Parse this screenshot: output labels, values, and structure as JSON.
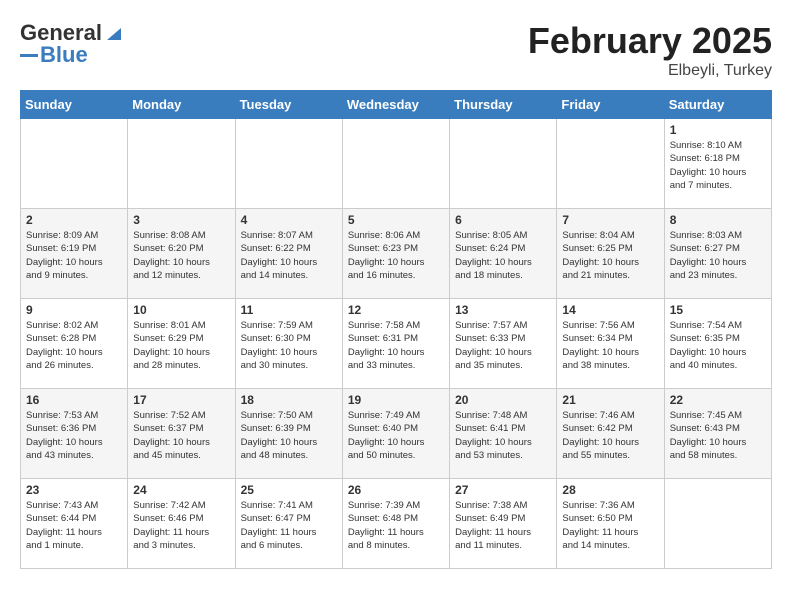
{
  "header": {
    "logo_general": "General",
    "logo_blue": "Blue",
    "month_year": "February 2025",
    "location": "Elbeyli, Turkey"
  },
  "days_of_week": [
    "Sunday",
    "Monday",
    "Tuesday",
    "Wednesday",
    "Thursday",
    "Friday",
    "Saturday"
  ],
  "weeks": [
    [
      {
        "day": "",
        "info": ""
      },
      {
        "day": "",
        "info": ""
      },
      {
        "day": "",
        "info": ""
      },
      {
        "day": "",
        "info": ""
      },
      {
        "day": "",
        "info": ""
      },
      {
        "day": "",
        "info": ""
      },
      {
        "day": "1",
        "info": "Sunrise: 8:10 AM\nSunset: 6:18 PM\nDaylight: 10 hours\nand 7 minutes."
      }
    ],
    [
      {
        "day": "2",
        "info": "Sunrise: 8:09 AM\nSunset: 6:19 PM\nDaylight: 10 hours\nand 9 minutes."
      },
      {
        "day": "3",
        "info": "Sunrise: 8:08 AM\nSunset: 6:20 PM\nDaylight: 10 hours\nand 12 minutes."
      },
      {
        "day": "4",
        "info": "Sunrise: 8:07 AM\nSunset: 6:22 PM\nDaylight: 10 hours\nand 14 minutes."
      },
      {
        "day": "5",
        "info": "Sunrise: 8:06 AM\nSunset: 6:23 PM\nDaylight: 10 hours\nand 16 minutes."
      },
      {
        "day": "6",
        "info": "Sunrise: 8:05 AM\nSunset: 6:24 PM\nDaylight: 10 hours\nand 18 minutes."
      },
      {
        "day": "7",
        "info": "Sunrise: 8:04 AM\nSunset: 6:25 PM\nDaylight: 10 hours\nand 21 minutes."
      },
      {
        "day": "8",
        "info": "Sunrise: 8:03 AM\nSunset: 6:27 PM\nDaylight: 10 hours\nand 23 minutes."
      }
    ],
    [
      {
        "day": "9",
        "info": "Sunrise: 8:02 AM\nSunset: 6:28 PM\nDaylight: 10 hours\nand 26 minutes."
      },
      {
        "day": "10",
        "info": "Sunrise: 8:01 AM\nSunset: 6:29 PM\nDaylight: 10 hours\nand 28 minutes."
      },
      {
        "day": "11",
        "info": "Sunrise: 7:59 AM\nSunset: 6:30 PM\nDaylight: 10 hours\nand 30 minutes."
      },
      {
        "day": "12",
        "info": "Sunrise: 7:58 AM\nSunset: 6:31 PM\nDaylight: 10 hours\nand 33 minutes."
      },
      {
        "day": "13",
        "info": "Sunrise: 7:57 AM\nSunset: 6:33 PM\nDaylight: 10 hours\nand 35 minutes."
      },
      {
        "day": "14",
        "info": "Sunrise: 7:56 AM\nSunset: 6:34 PM\nDaylight: 10 hours\nand 38 minutes."
      },
      {
        "day": "15",
        "info": "Sunrise: 7:54 AM\nSunset: 6:35 PM\nDaylight: 10 hours\nand 40 minutes."
      }
    ],
    [
      {
        "day": "16",
        "info": "Sunrise: 7:53 AM\nSunset: 6:36 PM\nDaylight: 10 hours\nand 43 minutes."
      },
      {
        "day": "17",
        "info": "Sunrise: 7:52 AM\nSunset: 6:37 PM\nDaylight: 10 hours\nand 45 minutes."
      },
      {
        "day": "18",
        "info": "Sunrise: 7:50 AM\nSunset: 6:39 PM\nDaylight: 10 hours\nand 48 minutes."
      },
      {
        "day": "19",
        "info": "Sunrise: 7:49 AM\nSunset: 6:40 PM\nDaylight: 10 hours\nand 50 minutes."
      },
      {
        "day": "20",
        "info": "Sunrise: 7:48 AM\nSunset: 6:41 PM\nDaylight: 10 hours\nand 53 minutes."
      },
      {
        "day": "21",
        "info": "Sunrise: 7:46 AM\nSunset: 6:42 PM\nDaylight: 10 hours\nand 55 minutes."
      },
      {
        "day": "22",
        "info": "Sunrise: 7:45 AM\nSunset: 6:43 PM\nDaylight: 10 hours\nand 58 minutes."
      }
    ],
    [
      {
        "day": "23",
        "info": "Sunrise: 7:43 AM\nSunset: 6:44 PM\nDaylight: 11 hours\nand 1 minute."
      },
      {
        "day": "24",
        "info": "Sunrise: 7:42 AM\nSunset: 6:46 PM\nDaylight: 11 hours\nand 3 minutes."
      },
      {
        "day": "25",
        "info": "Sunrise: 7:41 AM\nSunset: 6:47 PM\nDaylight: 11 hours\nand 6 minutes."
      },
      {
        "day": "26",
        "info": "Sunrise: 7:39 AM\nSunset: 6:48 PM\nDaylight: 11 hours\nand 8 minutes."
      },
      {
        "day": "27",
        "info": "Sunrise: 7:38 AM\nSunset: 6:49 PM\nDaylight: 11 hours\nand 11 minutes."
      },
      {
        "day": "28",
        "info": "Sunrise: 7:36 AM\nSunset: 6:50 PM\nDaylight: 11 hours\nand 14 minutes."
      },
      {
        "day": "",
        "info": ""
      }
    ]
  ]
}
